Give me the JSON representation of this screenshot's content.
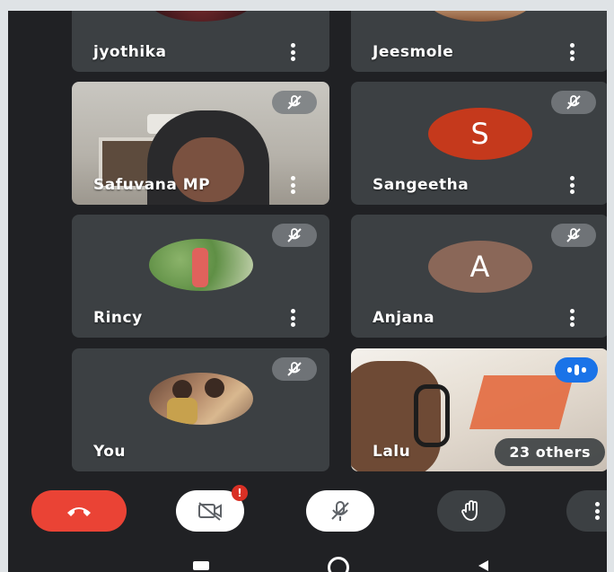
{
  "participants": [
    {
      "name": "jyothika",
      "tile": "partial-photo"
    },
    {
      "name": "Jeesmole",
      "tile": "partial-photo"
    },
    {
      "name": "Safuvana MP",
      "tile": "video",
      "muted": true
    },
    {
      "name": "Sangeetha",
      "tile": "letter",
      "letter": "S",
      "avatar_color": "#c5391c",
      "muted": true
    },
    {
      "name": "Rincy",
      "tile": "photo",
      "muted": true
    },
    {
      "name": "Anjana",
      "tile": "letter",
      "letter": "A",
      "avatar_color": "#8a6758",
      "muted": true
    },
    {
      "name": "You",
      "tile": "photo",
      "muted": true
    },
    {
      "name": "Lalu",
      "tile": "video",
      "speaking": true
    }
  ],
  "others_chip": "23 others",
  "controls": {
    "end_call": "end-call-icon",
    "camera": "camera-off-icon",
    "mic": "mic-off-icon",
    "hand": "raise-hand-icon",
    "more": "more-options-icon",
    "camera_alert": "!"
  },
  "colors": {
    "end_call": "#ea4335",
    "tile_bg": "#3c4043",
    "screen_bg": "#202124",
    "speaking": "#1a73e8"
  }
}
